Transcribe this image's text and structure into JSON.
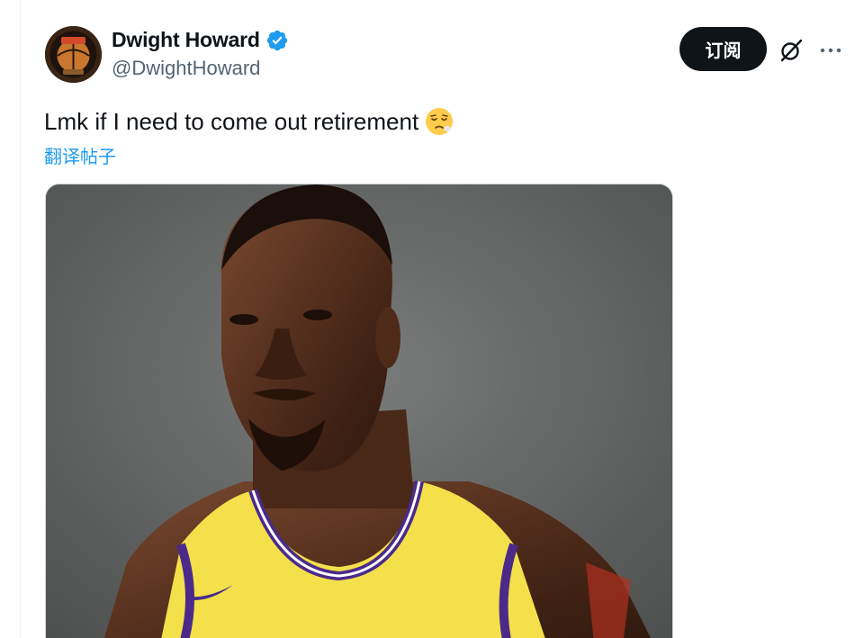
{
  "author": {
    "display_name": "Dwight Howard",
    "handle": "@DwightHoward",
    "verified": true
  },
  "actions": {
    "subscribe_label": "订阅"
  },
  "post": {
    "text": "Lmk if I need to come out retirement",
    "emoji": "relieved-face-emoji",
    "translate_label": "翻译帖子"
  },
  "media": {
    "description_icon": "player-portrait-image"
  },
  "colors": {
    "verified_blue": "#1d9bf0",
    "link_blue": "#1d9bf0",
    "text_primary": "#0f1419",
    "text_secondary": "#536471",
    "jersey_yellow": "#f4e04a",
    "jersey_purple": "#4b2a8a"
  }
}
